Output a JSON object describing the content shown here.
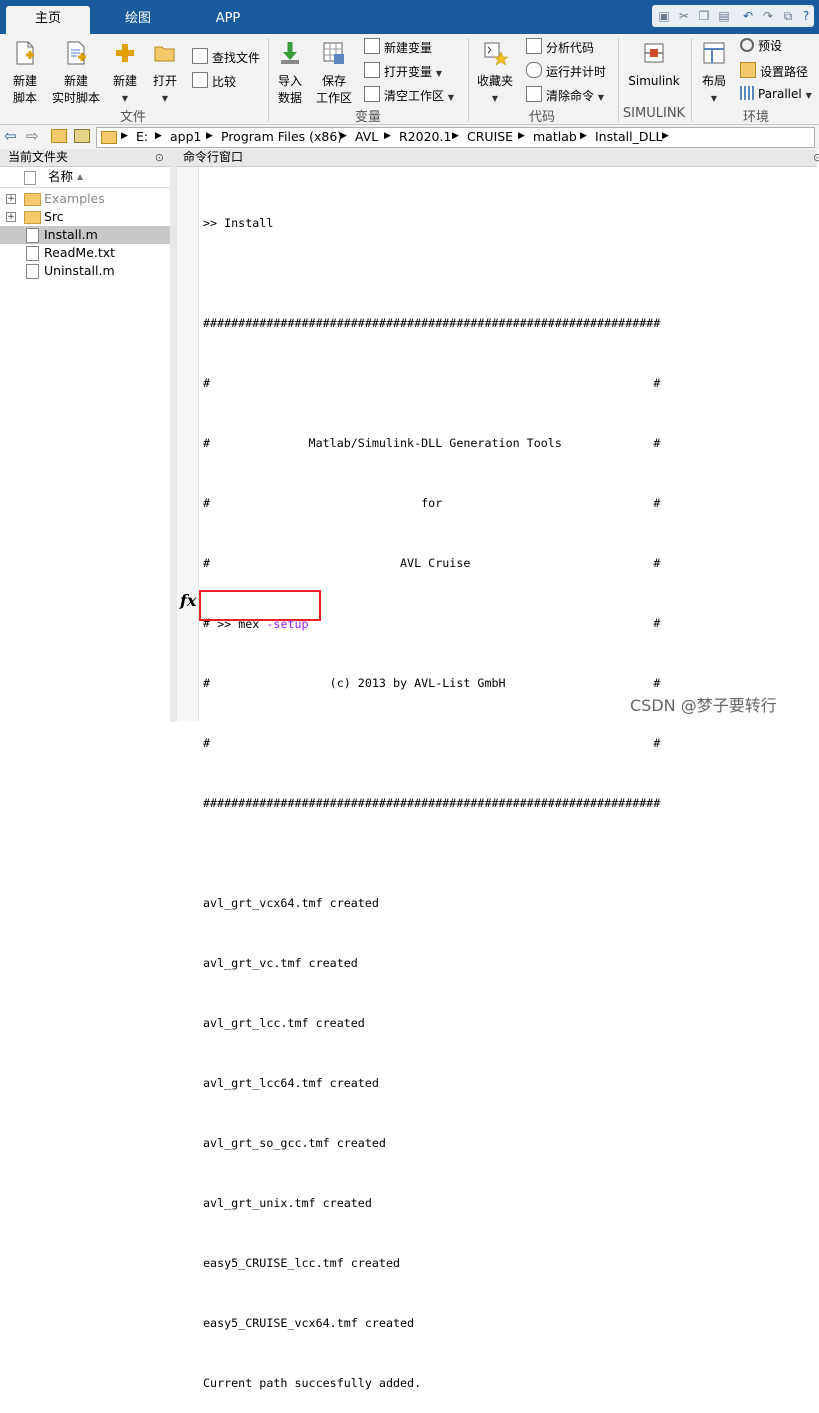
{
  "tabs": [
    {
      "label": "主页"
    },
    {
      "label": "绘图"
    },
    {
      "label": "APP"
    }
  ],
  "ribbon": {
    "file": {
      "new_script": "新建\n脚本",
      "new_live_script": "新建\n实时脚本",
      "new": "新建",
      "open": "打开",
      "find_files": "查找文件",
      "compare": "比较",
      "group_label": "文件"
    },
    "variable": {
      "import": "导入\n数据",
      "save_ws": "保存\n工作区",
      "new_var": "新建变量",
      "open_var": "打开变量",
      "clear_ws": "清空工作区",
      "group_label": "变量"
    },
    "code": {
      "favorites": "收藏夹",
      "analyze": "分析代码",
      "run_time": "运行并计时",
      "clear_cmds": "清除命令",
      "group_label": "代码"
    },
    "simulink": {
      "button": "Simulink",
      "group_label": "SIMULINK"
    },
    "env": {
      "layout": "布局",
      "prefs": "预设",
      "set_path": "设置路径",
      "parallel": "Parallel",
      "group_label": "环境"
    }
  },
  "address": {
    "crumbs": [
      "E:",
      "app1",
      "Program Files (x86)",
      "AVL",
      "R2020.1",
      "CRUISE",
      "matlab",
      "Install_DLL"
    ]
  },
  "file_browser": {
    "title": "当前文件夹",
    "column_name": "名称",
    "items": [
      {
        "name": "Examples"
      },
      {
        "name": "Src"
      },
      {
        "name": "Install.m"
      },
      {
        "name": "ReadMe.txt"
      },
      {
        "name": "Uninstall.m"
      }
    ]
  },
  "command_window": {
    "title": "命令行窗口",
    "lines": [
      ">> Install",
      "",
      "#################################################################",
      "#                                                               #",
      "#              Matlab/Simulink-DLL Generation Tools             #",
      "#                              for                              #",
      "#                           AVL Cruise                          #",
      "#                                                               #",
      "#                 (c) 2013 by AVL-List GmbH                     #",
      "#                                                               #",
      "#################################################################",
      "",
      "avl_grt_vcx64.tmf created",
      "avl_grt_vc.tmf created",
      "avl_grt_lcc.tmf created",
      "avl_grt_lcc64.tmf created",
      "avl_grt_so_gcc.tmf created",
      "avl_grt_unix.tmf created",
      "easy5_CRUISE_lcc.tmf created",
      "easy5_CRUISE_vcx64.tmf created",
      "Current path succesfully added."
    ],
    "prompt": ">>",
    "input_cmd": "mex",
    "input_arg": "-setup",
    "fx": "fx"
  },
  "watermark": "CSDN @梦子要转行",
  "colors": {
    "tab_bar": "#1a5a9e",
    "highlight_box": "#e8222a",
    "arg_purple": "#a020f0"
  }
}
